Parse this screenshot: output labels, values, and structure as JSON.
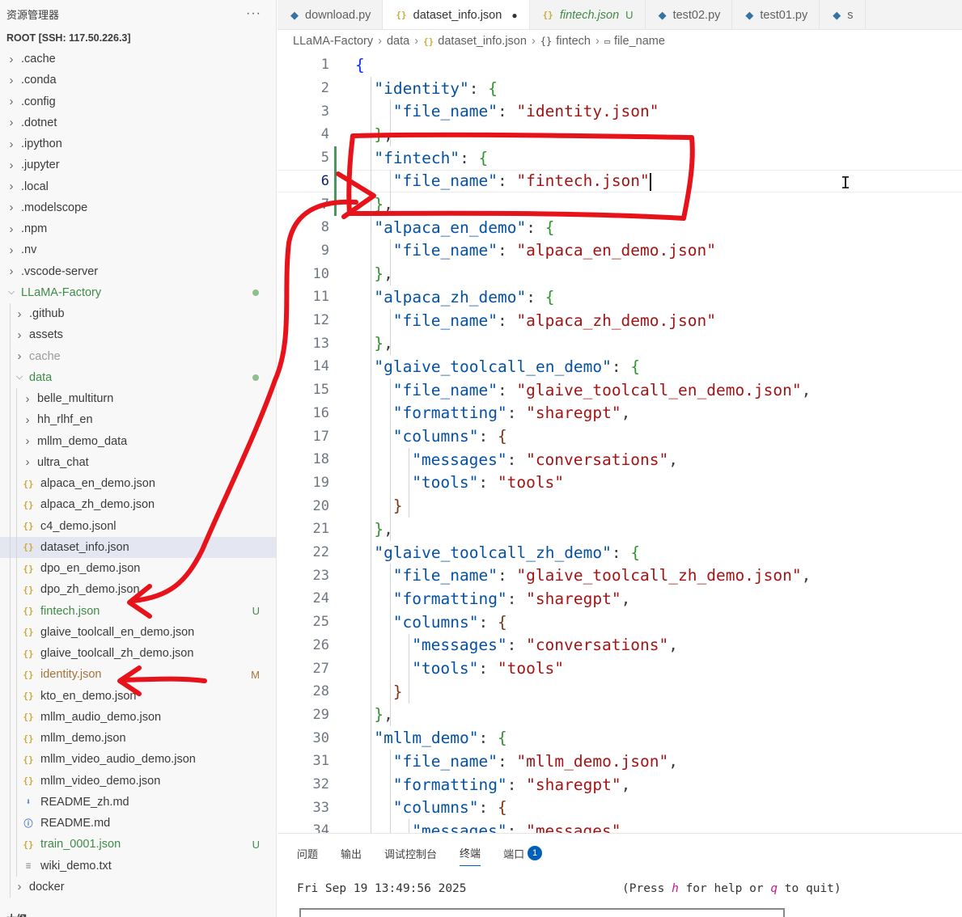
{
  "sidebar": {
    "title": "资源管理器",
    "more": "···",
    "root": "ROOT [SSH: 117.50.226.3]",
    "items": [
      {
        "label": ".cache",
        "depth": 0,
        "kind": "folder",
        "expanded": false
      },
      {
        "label": ".conda",
        "depth": 0,
        "kind": "folder",
        "expanded": false
      },
      {
        "label": ".config",
        "depth": 0,
        "kind": "folder",
        "expanded": false
      },
      {
        "label": ".dotnet",
        "depth": 0,
        "kind": "folder",
        "expanded": false
      },
      {
        "label": ".ipython",
        "depth": 0,
        "kind": "folder",
        "expanded": false
      },
      {
        "label": ".jupyter",
        "depth": 0,
        "kind": "folder",
        "expanded": false
      },
      {
        "label": ".local",
        "depth": 0,
        "kind": "folder",
        "expanded": false
      },
      {
        "label": ".modelscope",
        "depth": 0,
        "kind": "folder",
        "expanded": false
      },
      {
        "label": ".npm",
        "depth": 0,
        "kind": "folder",
        "expanded": false
      },
      {
        "label": ".nv",
        "depth": 0,
        "kind": "folder",
        "expanded": false
      },
      {
        "label": ".vscode-server",
        "depth": 0,
        "kind": "folder",
        "expanded": false
      },
      {
        "label": "LLaMA-Factory",
        "depth": 0,
        "kind": "folder",
        "expanded": true,
        "color": "green",
        "dot": true
      },
      {
        "label": ".github",
        "depth": 1,
        "kind": "folder",
        "expanded": false
      },
      {
        "label": "assets",
        "depth": 1,
        "kind": "folder",
        "expanded": false
      },
      {
        "label": "cache",
        "depth": 1,
        "kind": "folder",
        "expanded": false,
        "color": "grey"
      },
      {
        "label": "data",
        "depth": 1,
        "kind": "folder",
        "expanded": true,
        "color": "green",
        "dot": true
      },
      {
        "label": "belle_multiturn",
        "depth": 2,
        "kind": "folder",
        "expanded": false
      },
      {
        "label": "hh_rlhf_en",
        "depth": 2,
        "kind": "folder",
        "expanded": false
      },
      {
        "label": "mllm_demo_data",
        "depth": 2,
        "kind": "folder",
        "expanded": false
      },
      {
        "label": "ultra_chat",
        "depth": 2,
        "kind": "folder",
        "expanded": false
      },
      {
        "label": "alpaca_en_demo.json",
        "depth": 2,
        "kind": "json"
      },
      {
        "label": "alpaca_zh_demo.json",
        "depth": 2,
        "kind": "json"
      },
      {
        "label": "c4_demo.jsonl",
        "depth": 2,
        "kind": "json"
      },
      {
        "label": "dataset_info.json",
        "depth": 2,
        "kind": "json",
        "selected": true
      },
      {
        "label": "dpo_en_demo.json",
        "depth": 2,
        "kind": "json"
      },
      {
        "label": "dpo_zh_demo.json",
        "depth": 2,
        "kind": "json"
      },
      {
        "label": "fintech.json",
        "depth": 2,
        "kind": "json",
        "color": "green",
        "badge": "U"
      },
      {
        "label": "glaive_toolcall_en_demo.json",
        "depth": 2,
        "kind": "json"
      },
      {
        "label": "glaive_toolcall_zh_demo.json",
        "depth": 2,
        "kind": "json"
      },
      {
        "label": "identity.json",
        "depth": 2,
        "kind": "json",
        "color": "mod",
        "badge": "M"
      },
      {
        "label": "kto_en_demo.json",
        "depth": 2,
        "kind": "json"
      },
      {
        "label": "mllm_audio_demo.json",
        "depth": 2,
        "kind": "json"
      },
      {
        "label": "mllm_demo.json",
        "depth": 2,
        "kind": "json"
      },
      {
        "label": "mllm_video_audio_demo.json",
        "depth": 2,
        "kind": "json"
      },
      {
        "label": "mllm_video_demo.json",
        "depth": 2,
        "kind": "json"
      },
      {
        "label": "README_zh.md",
        "depth": 2,
        "kind": "md"
      },
      {
        "label": "README.md",
        "depth": 2,
        "kind": "info"
      },
      {
        "label": "train_0001.json",
        "depth": 2,
        "kind": "json",
        "color": "green",
        "badge": "U"
      },
      {
        "label": "wiki_demo.txt",
        "depth": 2,
        "kind": "txt"
      },
      {
        "label": "docker",
        "depth": 1,
        "kind": "folder",
        "expanded": false
      }
    ],
    "outline_label": "大纲"
  },
  "tabs": [
    {
      "label": "download.py",
      "icon": "python-icon"
    },
    {
      "label": "dataset_info.json",
      "icon": "json-icon",
      "active": true,
      "modified": true
    },
    {
      "label": "fintech.json",
      "icon": "json-icon",
      "untracked": "U"
    },
    {
      "label": "test02.py",
      "icon": "python-icon"
    },
    {
      "label": "test01.py",
      "icon": "python-icon"
    },
    {
      "label": "s",
      "icon": "python-icon"
    }
  ],
  "breadcrumb": [
    "LLaMA-Factory",
    "data",
    "dataset_info.json",
    "fintech",
    "file_name"
  ],
  "editor": {
    "lines": [
      {
        "n": 1,
        "indent": 0,
        "tokens": [
          [
            "b1",
            "{"
          ]
        ]
      },
      {
        "n": 2,
        "indent": 1,
        "tokens": [
          [
            "k",
            "\"identity\""
          ],
          [
            "p",
            ": "
          ],
          [
            "b2",
            "{"
          ]
        ]
      },
      {
        "n": 3,
        "indent": 2,
        "tokens": [
          [
            "k",
            "\"file_name\""
          ],
          [
            "p",
            ": "
          ],
          [
            "s",
            "\"identity.json\""
          ]
        ]
      },
      {
        "n": 4,
        "indent": 1,
        "tokens": [
          [
            "b2",
            "}"
          ],
          [
            "p",
            ","
          ]
        ]
      },
      {
        "n": 5,
        "indent": 1,
        "tokens": [
          [
            "k",
            "\"fintech\""
          ],
          [
            "p",
            ": "
          ],
          [
            "b2",
            "{"
          ]
        ]
      },
      {
        "n": 6,
        "indent": 2,
        "tokens": [
          [
            "k",
            "\"file_name\""
          ],
          [
            "p",
            ": "
          ],
          [
            "s",
            "\"fintech.json\""
          ]
        ],
        "current": true,
        "cursor": true
      },
      {
        "n": 7,
        "indent": 1,
        "tokens": [
          [
            "b2",
            "}"
          ],
          [
            "p",
            ","
          ]
        ]
      },
      {
        "n": 8,
        "indent": 1,
        "tokens": [
          [
            "k",
            "\"alpaca_en_demo\""
          ],
          [
            "p",
            ": "
          ],
          [
            "b2",
            "{"
          ]
        ]
      },
      {
        "n": 9,
        "indent": 2,
        "tokens": [
          [
            "k",
            "\"file_name\""
          ],
          [
            "p",
            ": "
          ],
          [
            "s",
            "\"alpaca_en_demo.json\""
          ]
        ]
      },
      {
        "n": 10,
        "indent": 1,
        "tokens": [
          [
            "b2",
            "}"
          ],
          [
            "p",
            ","
          ]
        ]
      },
      {
        "n": 11,
        "indent": 1,
        "tokens": [
          [
            "k",
            "\"alpaca_zh_demo\""
          ],
          [
            "p",
            ": "
          ],
          [
            "b2",
            "{"
          ]
        ]
      },
      {
        "n": 12,
        "indent": 2,
        "tokens": [
          [
            "k",
            "\"file_name\""
          ],
          [
            "p",
            ": "
          ],
          [
            "s",
            "\"alpaca_zh_demo.json\""
          ]
        ]
      },
      {
        "n": 13,
        "indent": 1,
        "tokens": [
          [
            "b2",
            "}"
          ],
          [
            "p",
            ","
          ]
        ]
      },
      {
        "n": 14,
        "indent": 1,
        "tokens": [
          [
            "k",
            "\"glaive_toolcall_en_demo\""
          ],
          [
            "p",
            ": "
          ],
          [
            "b2",
            "{"
          ]
        ]
      },
      {
        "n": 15,
        "indent": 2,
        "tokens": [
          [
            "k",
            "\"file_name\""
          ],
          [
            "p",
            ": "
          ],
          [
            "s",
            "\"glaive_toolcall_en_demo.json\""
          ],
          [
            "p",
            ","
          ]
        ]
      },
      {
        "n": 16,
        "indent": 2,
        "tokens": [
          [
            "k",
            "\"formatting\""
          ],
          [
            "p",
            ": "
          ],
          [
            "s",
            "\"sharegpt\""
          ],
          [
            "p",
            ","
          ]
        ]
      },
      {
        "n": 17,
        "indent": 2,
        "tokens": [
          [
            "k",
            "\"columns\""
          ],
          [
            "p",
            ": "
          ],
          [
            "b3",
            "{"
          ]
        ]
      },
      {
        "n": 18,
        "indent": 3,
        "tokens": [
          [
            "k",
            "\"messages\""
          ],
          [
            "p",
            ": "
          ],
          [
            "s",
            "\"conversations\""
          ],
          [
            "p",
            ","
          ]
        ]
      },
      {
        "n": 19,
        "indent": 3,
        "tokens": [
          [
            "k",
            "\"tools\""
          ],
          [
            "p",
            ": "
          ],
          [
            "s",
            "\"tools\""
          ]
        ]
      },
      {
        "n": 20,
        "indent": 2,
        "tokens": [
          [
            "b3",
            "}"
          ]
        ]
      },
      {
        "n": 21,
        "indent": 1,
        "tokens": [
          [
            "b2",
            "}"
          ],
          [
            "p",
            ","
          ]
        ]
      },
      {
        "n": 22,
        "indent": 1,
        "tokens": [
          [
            "k",
            "\"glaive_toolcall_zh_demo\""
          ],
          [
            "p",
            ": "
          ],
          [
            "b2",
            "{"
          ]
        ]
      },
      {
        "n": 23,
        "indent": 2,
        "tokens": [
          [
            "k",
            "\"file_name\""
          ],
          [
            "p",
            ": "
          ],
          [
            "s",
            "\"glaive_toolcall_zh_demo.json\""
          ],
          [
            "p",
            ","
          ]
        ]
      },
      {
        "n": 24,
        "indent": 2,
        "tokens": [
          [
            "k",
            "\"formatting\""
          ],
          [
            "p",
            ": "
          ],
          [
            "s",
            "\"sharegpt\""
          ],
          [
            "p",
            ","
          ]
        ]
      },
      {
        "n": 25,
        "indent": 2,
        "tokens": [
          [
            "k",
            "\"columns\""
          ],
          [
            "p",
            ": "
          ],
          [
            "b3",
            "{"
          ]
        ]
      },
      {
        "n": 26,
        "indent": 3,
        "tokens": [
          [
            "k",
            "\"messages\""
          ],
          [
            "p",
            ": "
          ],
          [
            "s",
            "\"conversations\""
          ],
          [
            "p",
            ","
          ]
        ]
      },
      {
        "n": 27,
        "indent": 3,
        "tokens": [
          [
            "k",
            "\"tools\""
          ],
          [
            "p",
            ": "
          ],
          [
            "s",
            "\"tools\""
          ]
        ]
      },
      {
        "n": 28,
        "indent": 2,
        "tokens": [
          [
            "b3",
            "}"
          ]
        ]
      },
      {
        "n": 29,
        "indent": 1,
        "tokens": [
          [
            "b2",
            "}"
          ],
          [
            "p",
            ","
          ]
        ]
      },
      {
        "n": 30,
        "indent": 1,
        "tokens": [
          [
            "k",
            "\"mllm_demo\""
          ],
          [
            "p",
            ": "
          ],
          [
            "b2",
            "{"
          ]
        ]
      },
      {
        "n": 31,
        "indent": 2,
        "tokens": [
          [
            "k",
            "\"file_name\""
          ],
          [
            "p",
            ": "
          ],
          [
            "s",
            "\"mllm_demo.json\""
          ],
          [
            "p",
            ","
          ]
        ]
      },
      {
        "n": 32,
        "indent": 2,
        "tokens": [
          [
            "k",
            "\"formatting\""
          ],
          [
            "p",
            ": "
          ],
          [
            "s",
            "\"sharegpt\""
          ],
          [
            "p",
            ","
          ]
        ]
      },
      {
        "n": 33,
        "indent": 2,
        "tokens": [
          [
            "k",
            "\"columns\""
          ],
          [
            "p",
            ": "
          ],
          [
            "b3",
            "{"
          ]
        ]
      },
      {
        "n": 34,
        "indent": 3,
        "tokens": [
          [
            "k",
            "\"messages\""
          ],
          [
            "p",
            ": "
          ],
          [
            "s",
            "\"messages\""
          ],
          [
            "p",
            ","
          ]
        ]
      }
    ]
  },
  "panel": {
    "tabs": [
      "问题",
      "输出",
      "调试控制台",
      "终端",
      "端口"
    ],
    "active_tab": "终端",
    "ports_badge": "1",
    "terminal_line": "Fri Sep 19 13:49:56 2025",
    "terminal_help_parts": [
      "(Press ",
      "h",
      " for help or ",
      "q",
      " to quit)"
    ]
  },
  "colors": {
    "json_key": "#0451a5",
    "json_string": "#a31515",
    "untracked_green": "#3f8b47",
    "modified_brown": "#a3733a",
    "annotation_red": "#e8121b",
    "accent_blue": "#005fb8"
  }
}
